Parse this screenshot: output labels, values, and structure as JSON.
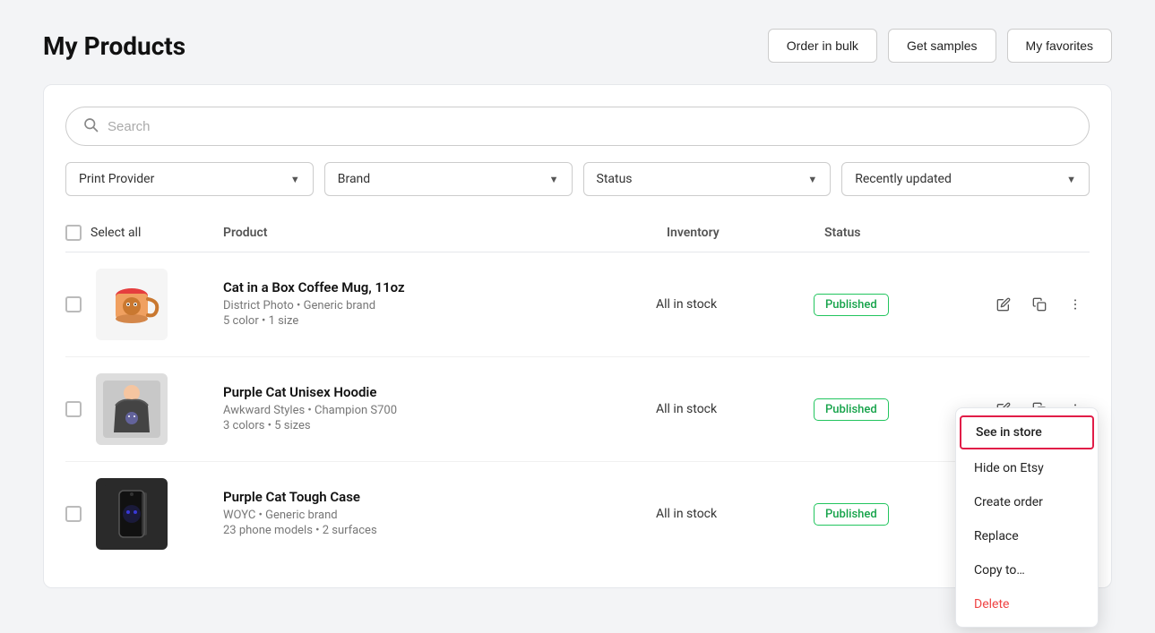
{
  "page": {
    "title": "My Products"
  },
  "header": {
    "actions": [
      {
        "id": "order-bulk",
        "label": "Order in bulk"
      },
      {
        "id": "get-samples",
        "label": "Get samples"
      },
      {
        "id": "my-favorites",
        "label": "My favorites"
      }
    ]
  },
  "search": {
    "placeholder": "Search"
  },
  "filters": [
    {
      "id": "print-provider",
      "label": "Print Provider"
    },
    {
      "id": "brand",
      "label": "Brand"
    },
    {
      "id": "status",
      "label": "Status"
    },
    {
      "id": "recently-updated",
      "label": "Recently updated"
    }
  ],
  "table": {
    "columns": {
      "select_all": "Select all",
      "product": "Product",
      "inventory": "Inventory",
      "status": "Status"
    },
    "rows": [
      {
        "id": "row-1",
        "name": "Cat in a Box Coffee Mug, 11oz",
        "meta1": "District Photo • Generic brand",
        "meta2": "5 color • 1 size",
        "inventory": "All in stock",
        "status": "Published",
        "showMenu": false
      },
      {
        "id": "row-2",
        "name": "Purple Cat Unisex Hoodie",
        "meta1": "Awkward Styles • Champion S700",
        "meta2": "3 colors • 5 sizes",
        "inventory": "All in stock",
        "status": "Published",
        "showMenu": true
      },
      {
        "id": "row-3",
        "name": "Purple Cat Tough Case",
        "meta1": "WOYC • Generic brand",
        "meta2": "23 phone models • 2 surfaces",
        "inventory": "All in stock",
        "status": "Published",
        "showMenu": false
      }
    ]
  },
  "context_menu": {
    "items": [
      {
        "id": "see-in-store",
        "label": "See in store",
        "highlight": true
      },
      {
        "id": "hide-on-etsy",
        "label": "Hide on Etsy"
      },
      {
        "id": "create-order",
        "label": "Create order"
      },
      {
        "id": "replace",
        "label": "Replace"
      },
      {
        "id": "copy-to",
        "label": "Copy to…"
      },
      {
        "id": "delete",
        "label": "Delete",
        "type": "delete"
      }
    ]
  },
  "product_images": {
    "row-1": {
      "bg": "#f5f5f5",
      "type": "mug"
    },
    "row-2": {
      "bg": "#e8e8e8",
      "type": "hoodie"
    },
    "row-3": {
      "bg": "#2a2a2a",
      "type": "case"
    }
  }
}
